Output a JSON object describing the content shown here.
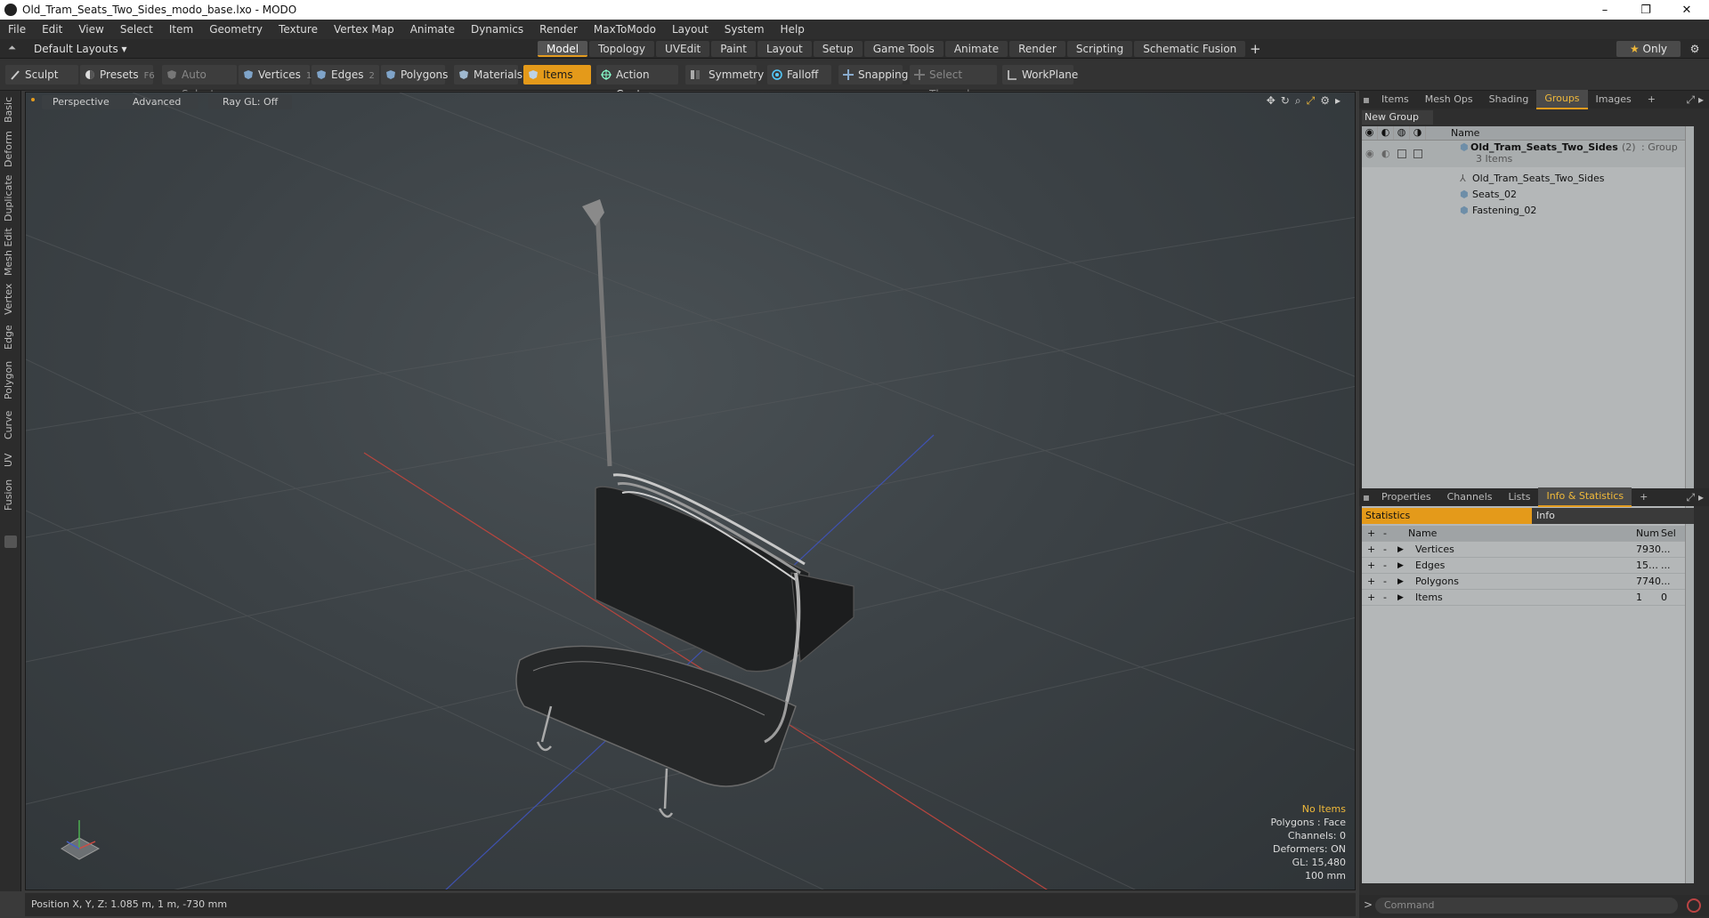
{
  "window": {
    "title": "Old_Tram_Seats_Two_Sides_modo_base.lxo - MODO",
    "minimize": "–",
    "maximize": "❐",
    "close": "✕"
  },
  "menu": [
    "File",
    "Edit",
    "View",
    "Select",
    "Item",
    "Geometry",
    "Texture",
    "Vertex Map",
    "Animate",
    "Dynamics",
    "Render",
    "MaxToModo",
    "Layout",
    "System",
    "Help"
  ],
  "layoutbar": {
    "layouts": "Default Layouts ▾",
    "tabs": [
      "Model",
      "Topology",
      "UVEdit",
      "Paint",
      "Layout",
      "Setup",
      "Game Tools",
      "Animate",
      "Render",
      "Scripting",
      "Schematic Fusion"
    ],
    "active_tab": "Model",
    "only": "Only"
  },
  "toolbar": {
    "sculpt": "Sculpt",
    "presets": "Presets",
    "presets_key": "F6",
    "auto_select": "Auto Select",
    "vertices": "Vertices",
    "vertices_key": "1",
    "edges": "Edges",
    "edges_key": "2",
    "polygons": "Polygons",
    "materials": "Materials",
    "items": "Items",
    "action_center": "Action Center",
    "symmetry": "Symmetry",
    "falloff": "Falloff",
    "snapping": "Snapping",
    "select_through": "Select Through",
    "workplane": "WorkPlane"
  },
  "sidetabs": [
    "Basic",
    "Deform",
    "Duplicate",
    "Mesh Edit",
    "Vertex",
    "Edge",
    "Polygon",
    "Curve",
    "UV",
    "Fusion"
  ],
  "viewport": {
    "perspective": "Perspective",
    "advanced": "Advanced",
    "raygl": "Ray GL: Off",
    "hud": {
      "no_items": "No Items",
      "polygons": "Polygons : Face",
      "channels": "Channels: 0",
      "deformers": "Deformers: ON",
      "gl": "GL: 15,480",
      "scale": "100 mm"
    }
  },
  "status": {
    "position": "Position X, Y, Z:  1.085 m, 1 m, -730 mm"
  },
  "top_panel": {
    "tabs": [
      "Items",
      "Mesh Ops",
      "Shading",
      "Groups",
      "Images"
    ],
    "active": "Groups",
    "new_group": "New Group",
    "col_name": "Name",
    "group": {
      "name": "Old_Tram_Seats_Two_Sides",
      "count": "(2)",
      "type": ": Group",
      "sub": "3 Items"
    },
    "children": [
      "Old_Tram_Seats_Two_Sides",
      "Seats_02",
      "Fastening_02"
    ]
  },
  "bottom_panel": {
    "tabs": [
      "Properties",
      "Channels",
      "Lists",
      "Info & Statistics"
    ],
    "active": "Info & Statistics",
    "statistics": "Statistics",
    "info": "Info",
    "cols": {
      "name": "Name",
      "num": "Num",
      "sel": "Sel"
    },
    "rows": [
      {
        "name": "Vertices",
        "num": "7930",
        "sel": "..."
      },
      {
        "name": "Edges",
        "num": "15…",
        "sel": "..."
      },
      {
        "name": "Polygons",
        "num": "7740",
        "sel": "..."
      },
      {
        "name": "Items",
        "num": "1",
        "sel": "0"
      }
    ]
  },
  "command": {
    "placeholder": "Command"
  }
}
